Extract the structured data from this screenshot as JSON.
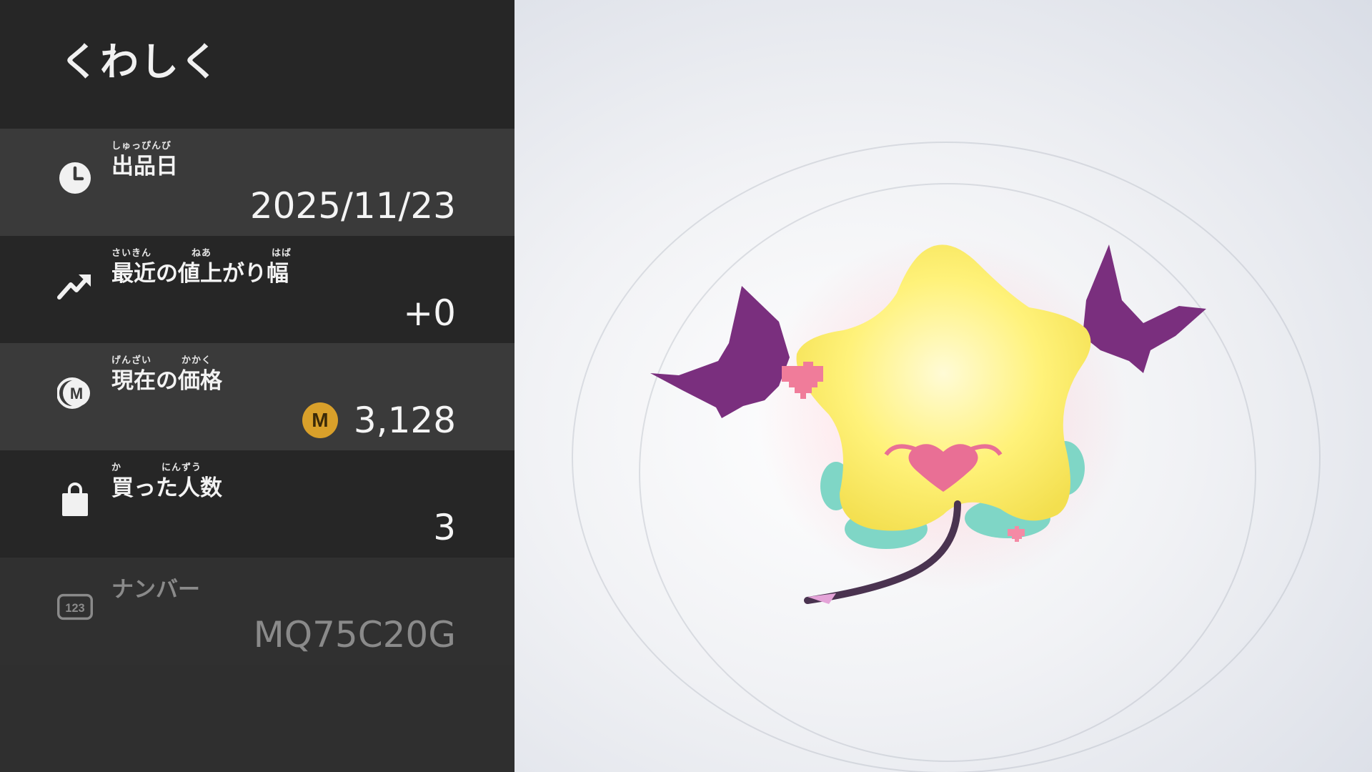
{
  "panel": {
    "title": "くわしく",
    "rows": [
      {
        "icon": "clock-icon",
        "furigana": "しゅっぴんび",
        "label": "出品日",
        "value": "2025/11/23"
      },
      {
        "icon": "trend-up-icon",
        "furigana": "さいきん　　　　ねあ　　　　　　はば",
        "label": "最近の値上がり幅",
        "value": "+0"
      },
      {
        "icon": "medal-coin-icon",
        "furigana": "げんざい　　　かかく",
        "label": "現在の価格",
        "value": "3,128",
        "coin_symbol": "M"
      },
      {
        "icon": "shopping-bag-icon",
        "furigana": "か　　　　にんずう",
        "label": "買った人数",
        "value": "3"
      },
      {
        "icon": "number-badge-icon",
        "icon_text": "123",
        "label": "ナンバー",
        "value": "MQ75C20G"
      }
    ]
  },
  "colors": {
    "panel_bg": "#2f2f2f",
    "row_light": "#3a3a3a",
    "row_dark": "#262626",
    "coin": "#d9a02a",
    "star_yellow": "#fff27a",
    "wing_purple": "#7a2f7e",
    "tail_purple": "#4a3350",
    "heart_pink": "#f07c9a",
    "feet_teal": "#7fd6c6"
  }
}
